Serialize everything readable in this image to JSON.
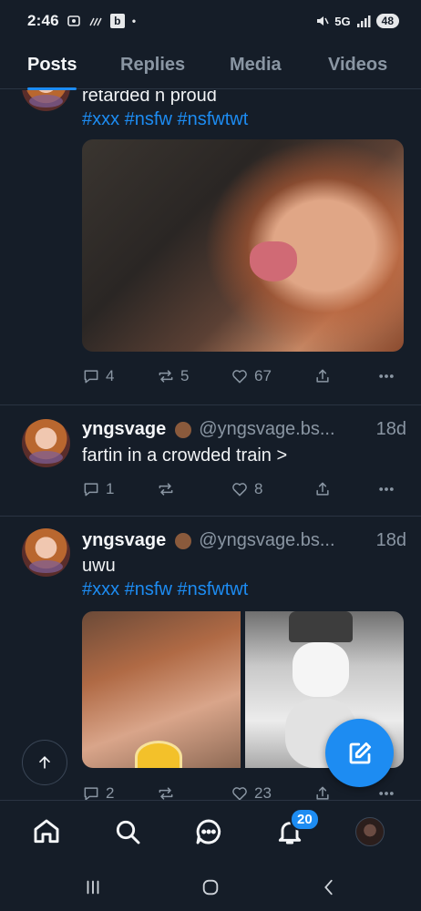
{
  "status_bar": {
    "time": "2:46",
    "left_icons": [
      "screenshot-icon",
      "wifi-calling-icon",
      "b-app-icon",
      "dot-icon"
    ],
    "network": "5G",
    "battery": "48"
  },
  "tabs": [
    {
      "label": "Posts",
      "active": true
    },
    {
      "label": "Replies",
      "active": false
    },
    {
      "label": "Media",
      "active": false
    },
    {
      "label": "Videos",
      "active": false
    }
  ],
  "posts": [
    {
      "text": "retarded n proud",
      "tags": "#xxx #nsfw #nsfwtwt",
      "media": "single-photo",
      "reply_count": "4",
      "repost_count": "5",
      "like_count": "67"
    },
    {
      "author": "yngsvage",
      "handle": "@yngsvage.bs...",
      "time": "18d",
      "text": "fartin in a crowded train >",
      "reply_count": "1",
      "repost_count": "",
      "like_count": "8"
    },
    {
      "author": "yngsvage",
      "handle": "@yngsvage.bs...",
      "time": "18d",
      "text": "uwu",
      "tags": "#xxx #nsfw #nsfwtwt",
      "media": "two-photos",
      "reply_count": "2",
      "repost_count": "",
      "like_count": "23"
    }
  ],
  "bottom_nav": {
    "items": [
      "home-icon",
      "search-icon",
      "chat-icon",
      "bell-icon",
      "profile-avatar"
    ],
    "notification_badge": "20"
  },
  "colors": {
    "background": "#151d28",
    "accent": "#1d8cf2",
    "muted_text": "#8a96a3"
  }
}
